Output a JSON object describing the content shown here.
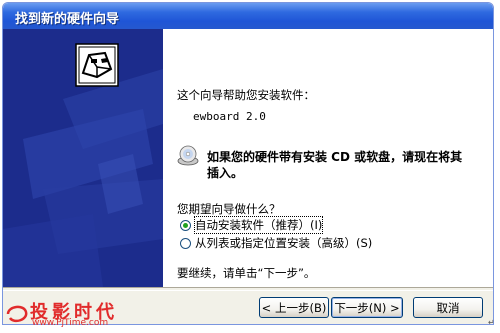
{
  "window": {
    "title": "找到新的硬件向导"
  },
  "content": {
    "intro": "这个向导帮助您安装软件：",
    "device_name": "ewboard 2.0",
    "cd_prompt_line1": "如果您的硬件带有安装 CD 或软盘，请现在将其",
    "cd_prompt_line2": "插入。",
    "question": "您期望向导做什么？",
    "options": [
      {
        "label": "自动安装软件（推荐）(I)",
        "selected": true
      },
      {
        "label": "从列表或指定位置安装（高级）(S)",
        "selected": false
      }
    ],
    "continue_hint": "要继续，请单击“下一步”。"
  },
  "buttons": {
    "back": "< 上一步(B)",
    "next": "下一步(N) >",
    "cancel": "取消"
  },
  "watermark": {
    "logo_text": "投影时代",
    "url": "www.PjTime.com"
  },
  "colors": {
    "titlebar": "#245edb",
    "sidebar": "#1c2c8c",
    "dialog_bg": "#f2f1e8",
    "radio_dot": "#21a121",
    "watermark": "#e12b2b"
  }
}
